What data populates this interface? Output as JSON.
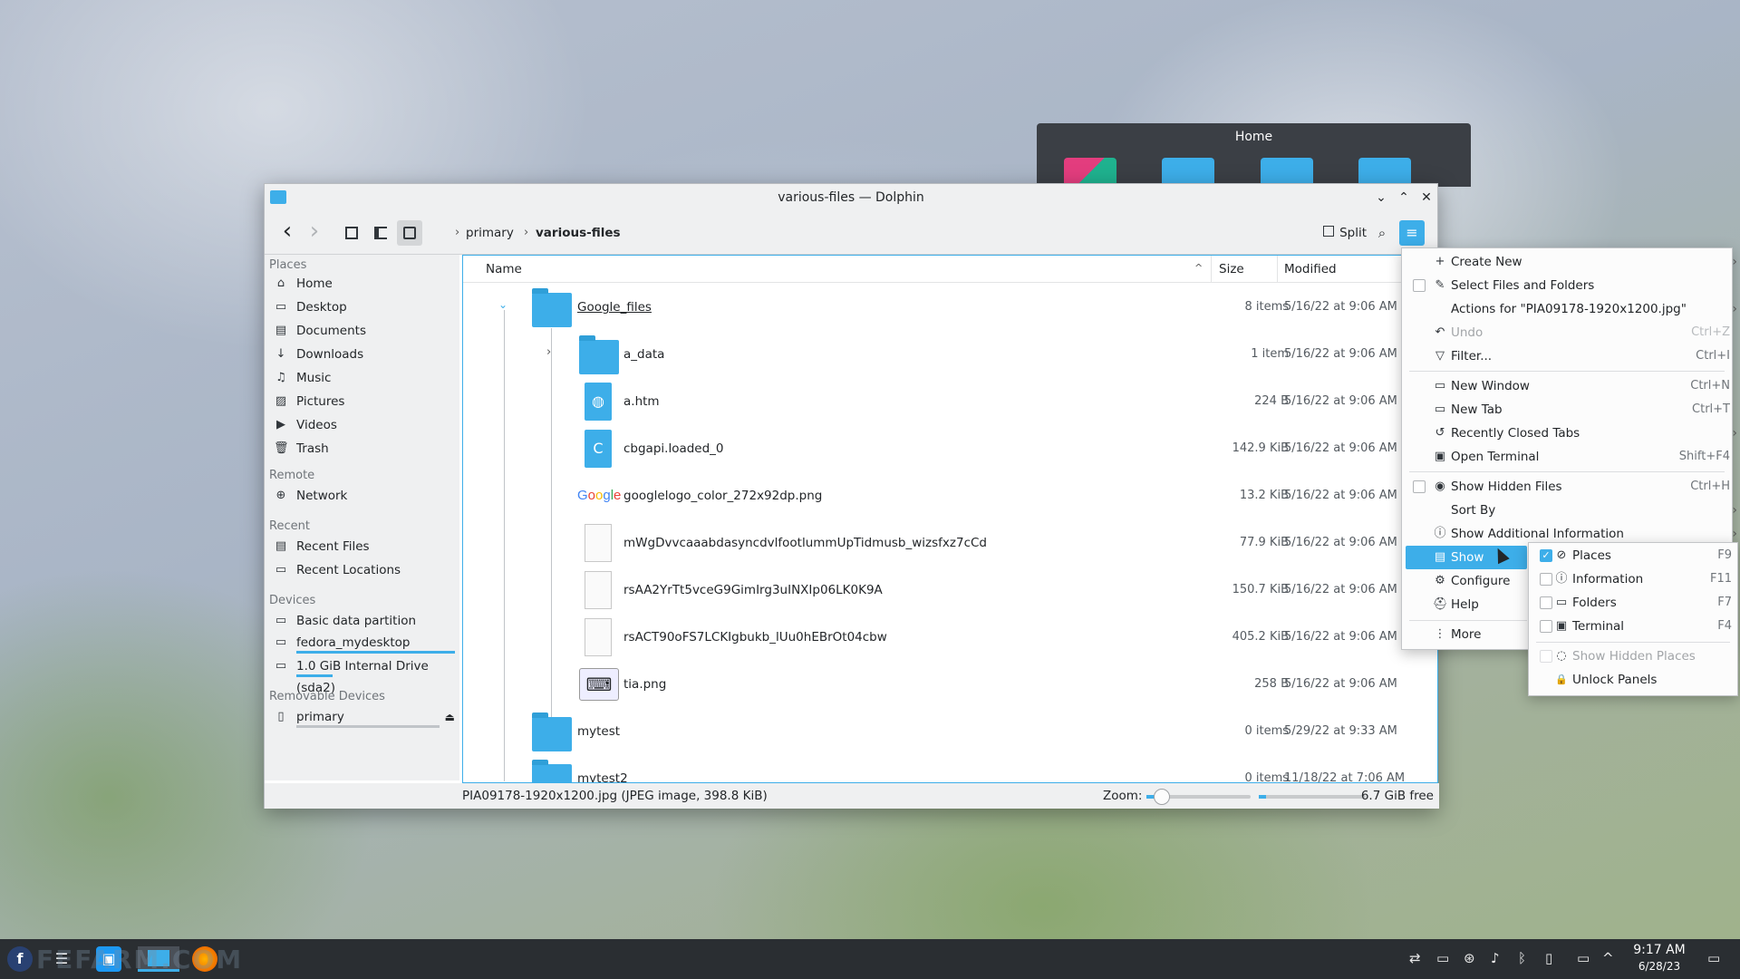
{
  "home_window": {
    "title": "Home"
  },
  "window": {
    "title": "various-files — Dolphin",
    "minimize": "⌄",
    "maximize": "⌃",
    "close": "✕"
  },
  "toolbar": {
    "back": "‹",
    "forward": "›",
    "split_label": "Split",
    "breadcrumb": [
      "primary",
      "various-files"
    ]
  },
  "sidebar": {
    "places_header": "Places",
    "places": [
      {
        "label": "Home",
        "icon": "⌂"
      },
      {
        "label": "Desktop",
        "icon": "▭"
      },
      {
        "label": "Documents",
        "icon": "▤"
      },
      {
        "label": "Downloads",
        "icon": "↓"
      },
      {
        "label": "Music",
        "icon": "♫"
      },
      {
        "label": "Pictures",
        "icon": "▨"
      },
      {
        "label": "Videos",
        "icon": "▶"
      },
      {
        "label": "Trash",
        "icon": "🗑"
      }
    ],
    "remote_header": "Remote",
    "remote": [
      {
        "label": "Network",
        "icon": "⊕"
      }
    ],
    "recent_header": "Recent",
    "recent": [
      {
        "label": "Recent Files",
        "icon": "▤"
      },
      {
        "label": "Recent Locations",
        "icon": "▭"
      }
    ],
    "devices_header": "Devices",
    "devices": [
      {
        "label": "Basic data partition",
        "icon": "▭"
      },
      {
        "label": "fedora_mydesktop",
        "icon": "▭"
      },
      {
        "label": "1.0 GiB Internal Drive (sda2)",
        "icon": "▭"
      }
    ],
    "removable_header": "Removable Devices",
    "removable": [
      {
        "label": "primary",
        "icon": "▯"
      }
    ]
  },
  "columns": {
    "name": "Name",
    "size": "Size",
    "modified": "Modified"
  },
  "files": [
    {
      "name": "Google_files",
      "size": "8 items",
      "modified": "5/16/22 at 9:06 AM"
    },
    {
      "name": "a_data",
      "size": "1 item",
      "modified": "5/16/22 at 9:06 AM"
    },
    {
      "name": "a.htm",
      "size": "224 B",
      "modified": "5/16/22 at 9:06 AM"
    },
    {
      "name": "cbgapi.loaded_0",
      "size": "142.9 KiB",
      "modified": "5/16/22 at 9:06 AM"
    },
    {
      "name": "googlelogo_color_272x92dp.png",
      "size": "13.2 KiB",
      "modified": "5/16/22 at 9:06 AM"
    },
    {
      "name": "mWgDvvcaaabdasyncdvlfootlummUpTidmusb_wizsfxz7cCd",
      "size": "77.9 KiB",
      "modified": "5/16/22 at 9:06 AM"
    },
    {
      "name": "rsAA2YrTt5vceG9GimIrg3uINXIp06LK0K9A",
      "size": "150.7 KiB",
      "modified": "5/16/22 at 9:06 AM"
    },
    {
      "name": "rsACT90oFS7LCKIgbukb_lUu0hEBrOt04cbw",
      "size": "405.2 KiB",
      "modified": "5/16/22 at 9:06 AM"
    },
    {
      "name": "tia.png",
      "size": "258 B",
      "modified": "5/16/22 at 9:06 AM"
    },
    {
      "name": "mytest",
      "size": "0 items",
      "modified": "5/29/22 at 9:33 AM"
    },
    {
      "name": "mytest2",
      "size": "0 items",
      "modified": "11/18/22 at 7:06 AM"
    }
  ],
  "google_logo": "Google",
  "status": {
    "text": "PIA09178-1920x1200.jpg (JPEG image, 398.8 KiB)",
    "zoom_label": "Zoom:",
    "free": "6.7 GiB free"
  },
  "menu": {
    "items": [
      {
        "label": "Create New",
        "icon": "+"
      },
      {
        "label": "Select Files and Folders",
        "icon": "✎"
      },
      {
        "label": "Actions for \"PIA09178-1920x1200.jpg\""
      },
      {
        "label": "Undo",
        "shortcut": "Ctrl+Z",
        "icon": "↶"
      },
      {
        "label": "Filter...",
        "shortcut": "Ctrl+I",
        "icon": "▽"
      },
      {
        "label": "New Window",
        "shortcut": "Ctrl+N",
        "icon": "▭"
      },
      {
        "label": "New Tab",
        "shortcut": "Ctrl+T",
        "icon": "▭"
      },
      {
        "label": "Recently Closed Tabs",
        "icon": "↺"
      },
      {
        "label": "Open Terminal",
        "shortcut": "Shift+F4",
        "icon": "▣"
      },
      {
        "label": "Show Hidden Files",
        "shortcut": "Ctrl+H",
        "icon": "◉"
      },
      {
        "label": "Sort By"
      },
      {
        "label": "Show Additional Information",
        "icon": "ⓘ"
      },
      {
        "label": "Show Panels",
        "icon": "▤"
      },
      {
        "label": "Configure",
        "icon": "⚙"
      },
      {
        "label": "Help",
        "icon": "⛑"
      },
      {
        "label": "More",
        "icon": "⋮"
      }
    ]
  },
  "submenu": {
    "items": [
      {
        "label": "Places",
        "shortcut": "F9",
        "checked": true,
        "icon": "⊘"
      },
      {
        "label": "Information",
        "shortcut": "F11",
        "icon": "ⓘ"
      },
      {
        "label": "Folders",
        "shortcut": "F7",
        "icon": "▭"
      },
      {
        "label": "Terminal",
        "shortcut": "F4",
        "icon": "▣"
      },
      {
        "label": "Show Hidden Places",
        "icon": "◌"
      },
      {
        "label": "Unlock Panels",
        "icon": "🔒"
      }
    ]
  },
  "taskbar": {
    "watermark": "FEFARM.COM",
    "time": "9:17 AM",
    "date": "6/28/23"
  },
  "colors": {
    "accent": "#3daee9",
    "taskbar": "#2a2e32"
  }
}
